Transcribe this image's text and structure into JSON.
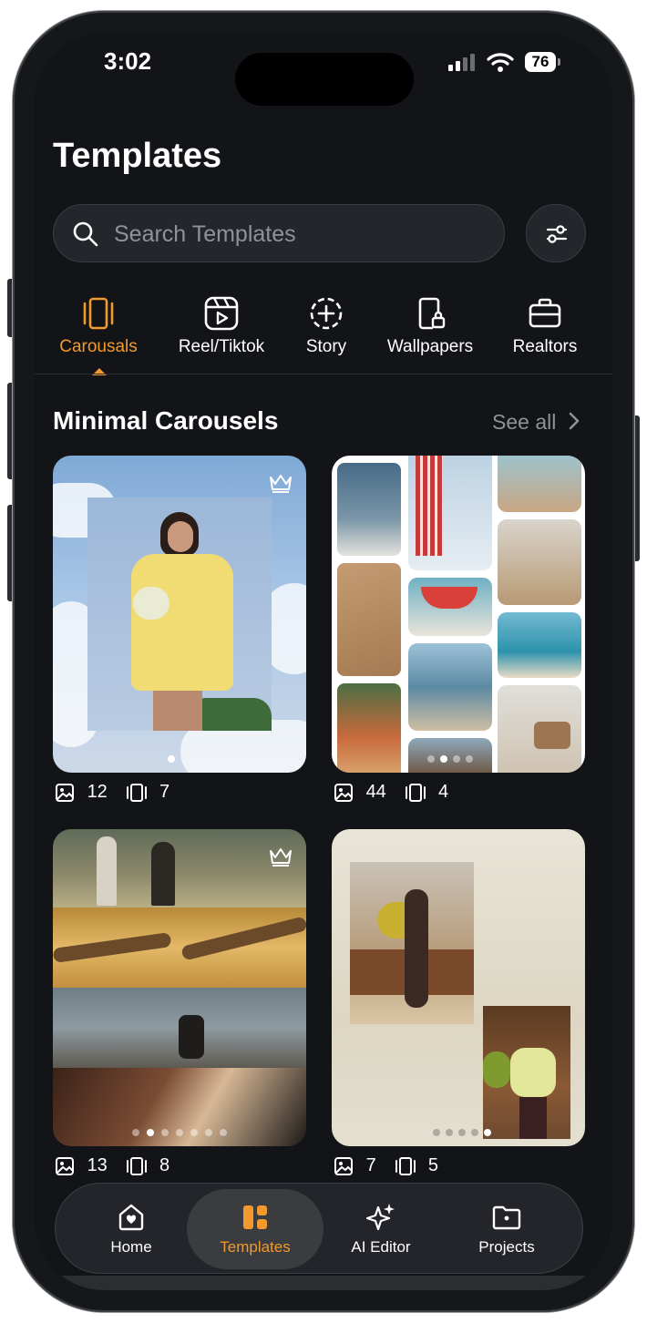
{
  "status_bar": {
    "time": "3:02",
    "battery": "76"
  },
  "header": {
    "title": "Templates"
  },
  "search": {
    "placeholder": "Search Templates"
  },
  "categories": [
    {
      "label": "Carousals",
      "icon": "carousel-icon",
      "active": true
    },
    {
      "label": "Reel/Tiktok",
      "icon": "reel-icon",
      "active": false
    },
    {
      "label": "Story",
      "icon": "story-add-icon",
      "active": false
    },
    {
      "label": "Wallpapers",
      "icon": "phone-lock-icon",
      "active": false
    },
    {
      "label": "Realtors",
      "icon": "briefcase-icon",
      "active": false
    }
  ],
  "section": {
    "title": "Minimal Carousels",
    "see_all": "See all"
  },
  "templates": [
    {
      "photos": "12",
      "slides": "7",
      "premium": true,
      "dots": 2,
      "active_dot": 1
    },
    {
      "photos": "44",
      "slides": "4",
      "premium": false,
      "dots": 4,
      "active_dot": 2
    },
    {
      "photos": "13",
      "slides": "8",
      "premium": true,
      "dots": 7,
      "active_dot": 2
    },
    {
      "photos": "7",
      "slides": "5",
      "premium": false,
      "dots": 5,
      "active_dot": 5
    }
  ],
  "tabbar": [
    {
      "label": "Home",
      "icon": "home-icon",
      "active": false
    },
    {
      "label": "Templates",
      "icon": "templates-grid-icon",
      "active": true
    },
    {
      "label": "AI Editor",
      "icon": "sparkles-icon",
      "active": false
    },
    {
      "label": "Projects",
      "icon": "folder-icon",
      "active": false
    }
  ],
  "colors": {
    "accent": "#f29a2e",
    "background": "#121418",
    "surface": "#23262b"
  }
}
